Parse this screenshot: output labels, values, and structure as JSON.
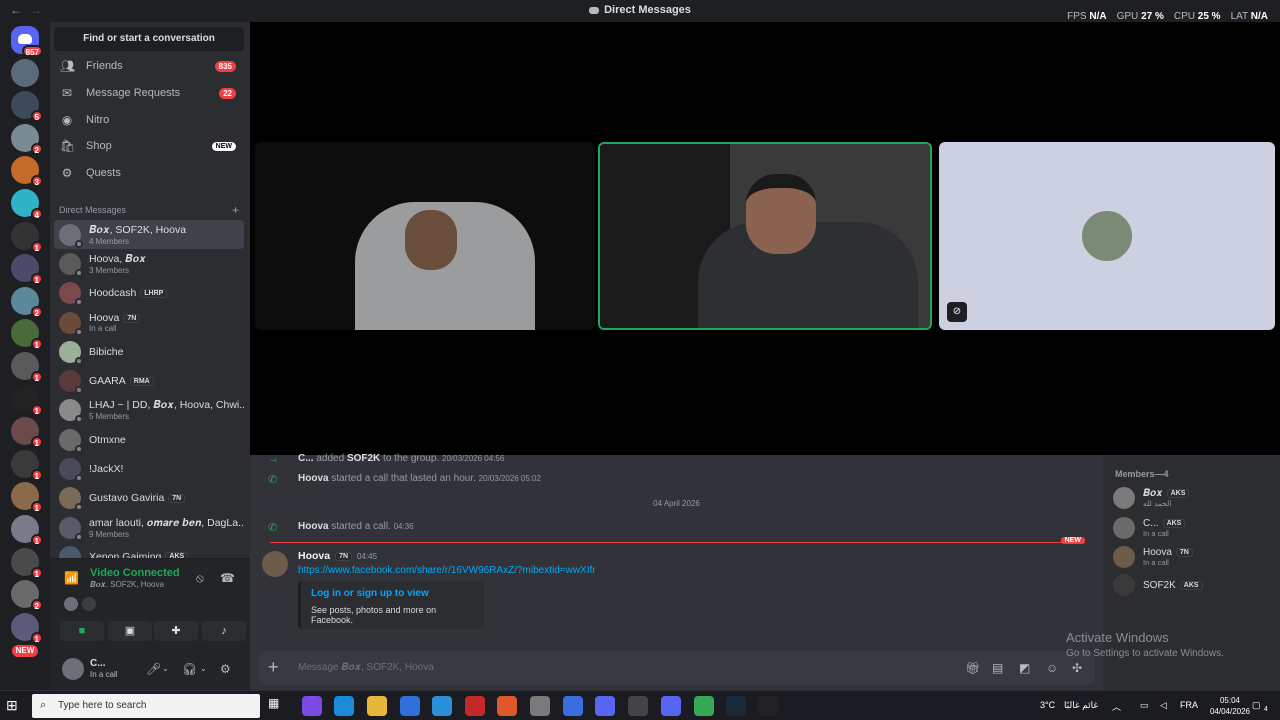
{
  "window": {
    "title": "Direct Messages",
    "perf": {
      "fps_label": "FPS",
      "fps": "N/A",
      "gpu_label": "GPU",
      "gpu": "27 %",
      "cpu_label": "CPU",
      "cpu": "25 %",
      "lat_label": "LAT",
      "lat": "N/A"
    }
  },
  "guilds": {
    "home_badge": "857",
    "badges": [
      "",
      "5",
      "2",
      "3",
      "4",
      "1",
      "1",
      "2",
      "1",
      "1",
      "1",
      "1",
      "1",
      "1",
      "1",
      "1",
      "2",
      "1"
    ],
    "new_label": "NEW"
  },
  "sidebar": {
    "find": "Find or start a conversation",
    "nav": [
      {
        "label": "Friends",
        "icon": "friends-icon",
        "count": "835"
      },
      {
        "label": "Message Requests",
        "icon": "mail-icon",
        "count": "22"
      },
      {
        "label": "Nitro",
        "icon": "nitro-icon",
        "count": ""
      },
      {
        "label": "Shop",
        "icon": "shop-icon",
        "tag": "NEW"
      },
      {
        "label": "Quests",
        "icon": "quests-icon",
        "count": ""
      }
    ],
    "dm_header": "Direct Messages",
    "dms": [
      {
        "name": "𝑩𝒐𝒙, SOF2K, Hoova",
        "sub": "4 Members",
        "active": true
      },
      {
        "name": "Hoova, 𝑩𝒐𝒙",
        "sub": "3 Members"
      },
      {
        "name": "Hoodcash",
        "tag": "LHRP",
        "sub": ""
      },
      {
        "name": "Hoova",
        "tag": "7N",
        "sub": "In a call"
      },
      {
        "name": "Bibiche",
        "sub": ""
      },
      {
        "name": "GAARA",
        "tag": "RMA",
        "sub": ""
      },
      {
        "name": "LHAJ ~ | DD, 𝑩𝒐𝒙, Hoova, Chwi...",
        "sub": "5 Members"
      },
      {
        "name": "Otmxne",
        "sub": ""
      },
      {
        "name": "!JackX!",
        "sub": ""
      },
      {
        "name": "Gustavo Gaviria",
        "tag": "7N",
        "sub": ""
      },
      {
        "name": "amar laouti, 𝒐𝒎𝒂𝒓𝒆 𝒃𝒆𝒏, DagLa...",
        "sub": "9 Members"
      },
      {
        "name": "Xenon Gaiming",
        "tag": "AKS",
        "sub": ""
      }
    ]
  },
  "voice": {
    "status": "Video Connected",
    "channel": "𝑩𝒐𝒙, SOF2K, Hoova"
  },
  "user": {
    "name": "C...",
    "status": "In a call"
  },
  "chat": {
    "sys1": {
      "actor": "C...",
      "mid": " added ",
      "target": "SOF2K",
      "end": " to the group.",
      "time": "20/03/2026 04:56"
    },
    "sys2": {
      "actor": "Hoova",
      "text": " started a call that lasted an hour.",
      "time": "20/03/2026 05:02"
    },
    "date": "04 April 2026",
    "sys3": {
      "actor": "Hoova",
      "text": " started a call.",
      "time": "04:36"
    },
    "new_label": "NEW",
    "message": {
      "author": "Hoova",
      "tag": "7N",
      "time": "04:45",
      "link": "https://www.facebook.com/share/r/16VW96RAxZ/?mibextid=wwXIfr",
      "embed_title": "Log in or sign up to view",
      "embed_desc": "See posts, photos and more on Facebook."
    },
    "placeholder": "Message 𝑩𝒐𝒙, SOF2K, Hoova"
  },
  "members": {
    "header": "Members—4",
    "list": [
      {
        "name": "𝑩𝒐𝒙",
        "tag": "AKS",
        "sub": "الحمد لله"
      },
      {
        "name": "C...",
        "tag": "AKS",
        "sub": "In a call"
      },
      {
        "name": "Hoova",
        "tag": "7N",
        "sub": "In a call"
      },
      {
        "name": "SOF2K",
        "tag": "AKS",
        "sub": ""
      }
    ]
  },
  "watermark": {
    "title": "Activate Windows",
    "sub": "Go to Settings to activate Windows."
  },
  "taskbar": {
    "search": "Type here to search",
    "weather": "3°C",
    "weather_text": "غائم غالبًا",
    "lang": "FRA",
    "time": "05:04",
    "date": "04/04/2026",
    "notif": "4"
  },
  "colors": {
    "accent": "#5865f2",
    "online": "#23a55a",
    "danger": "#f23f43",
    "link": "#00a8fc"
  }
}
